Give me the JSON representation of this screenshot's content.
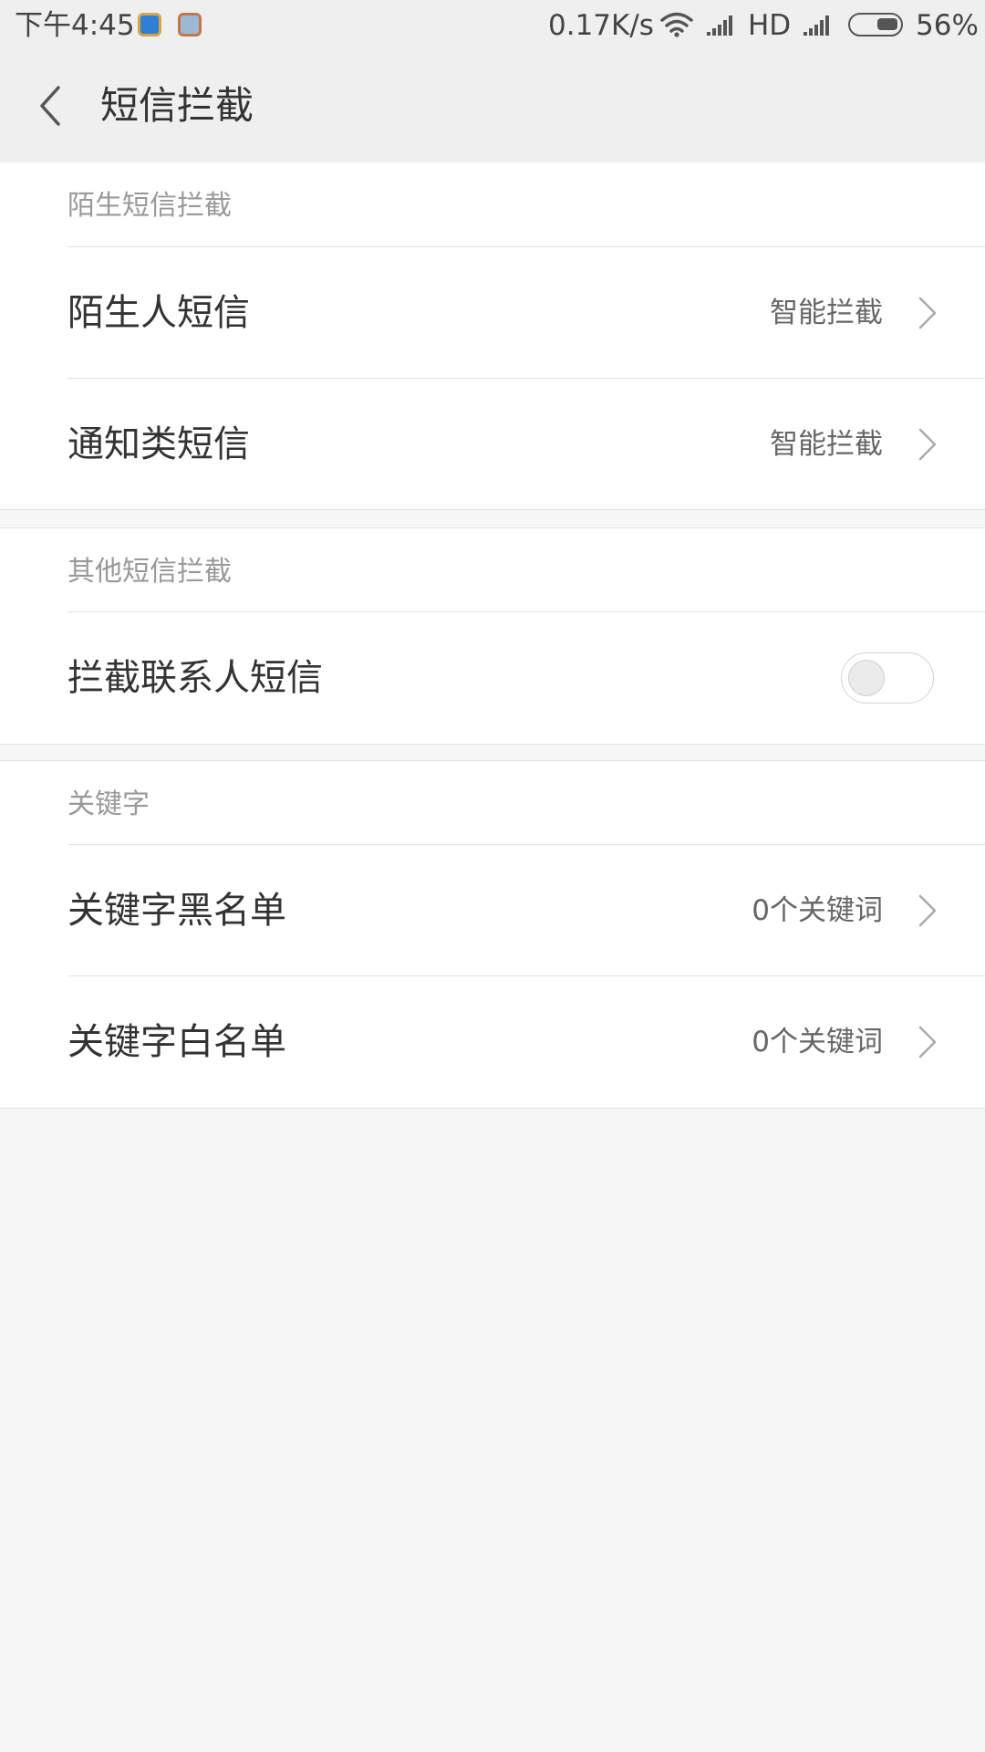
{
  "status_bar": {
    "time": "下午4:45",
    "net_speed": "0.17K/s",
    "network_type": "HD",
    "battery_percent": "56%",
    "battery_level": 0.56,
    "icons": [
      "app-notification-icon",
      "gallery-notification-icon",
      "wifi-icon",
      "signal-icon",
      "battery-icon"
    ]
  },
  "header": {
    "back_icon": "chevron-left-icon",
    "title": "短信拦截"
  },
  "stranger_section": {
    "title": "陌生短信拦截",
    "items": [
      {
        "label": "陌生人短信",
        "value": "智能拦截"
      },
      {
        "label": "通知类短信",
        "value": "智能拦截"
      }
    ]
  },
  "other_section": {
    "title": "其他短信拦截",
    "items": [
      {
        "label": "拦截联系人短信",
        "toggle_on": false
      }
    ]
  },
  "keyword_section": {
    "title": "关键字",
    "items": [
      {
        "label": "关键字黑名单",
        "value": "0个关键词"
      },
      {
        "label": "关键字白名单",
        "value": "0个关键词"
      }
    ]
  },
  "colors": {
    "header_bg": "#efefef",
    "page_bg": "#f6f6f6",
    "card_bg": "#ffffff",
    "section_title": "#999999",
    "primary_text": "#333333"
  }
}
